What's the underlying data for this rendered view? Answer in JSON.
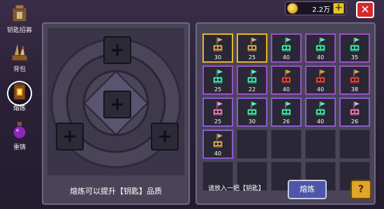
{
  "header": {
    "currency_value": "2.2万",
    "plus_label": "+",
    "close_label": "✕"
  },
  "tabs": [
    {
      "label": "钥匙招募",
      "icon": "altar-icon",
      "active": false
    },
    {
      "label": "背包",
      "icon": "weapon-rack-icon",
      "active": false
    },
    {
      "label": "熔炼",
      "icon": "furnace-icon",
      "active": true
    },
    {
      "label": "重铸",
      "icon": "potion-icon",
      "active": false
    }
  ],
  "smelt_panel": {
    "caption": "熔炼可以提升【钥匙】品质",
    "slot_plus": "+"
  },
  "inventory": {
    "cells": [
      {
        "value": "30",
        "color": "gold",
        "key": "brown"
      },
      {
        "value": "25",
        "color": "gold",
        "key": "brown"
      },
      {
        "value": "40",
        "color": "purple",
        "key": "green"
      },
      {
        "value": "40",
        "color": "purple",
        "key": "green"
      },
      {
        "value": "35",
        "color": "purple",
        "key": "green"
      },
      {
        "value": "25",
        "color": "purple",
        "key": "green"
      },
      {
        "value": "22",
        "color": "purple",
        "key": "green"
      },
      {
        "value": "40",
        "color": "purple",
        "key": "red"
      },
      {
        "value": "40",
        "color": "purple",
        "key": "red"
      },
      {
        "value": "38",
        "color": "purple",
        "key": "red"
      },
      {
        "value": "25",
        "color": "violet",
        "key": "pink"
      },
      {
        "value": "30",
        "color": "violet",
        "key": "green"
      },
      {
        "value": "26",
        "color": "violet",
        "key": "green"
      },
      {
        "value": "40",
        "color": "violet",
        "key": "green"
      },
      {
        "value": "26",
        "color": "violet",
        "key": "pink"
      },
      {
        "value": "40",
        "color": "violet",
        "key": "brown"
      },
      {
        "value": "",
        "color": "empty"
      },
      {
        "value": "",
        "color": "empty"
      },
      {
        "value": "",
        "color": "empty"
      },
      {
        "value": "",
        "color": "empty"
      },
      {
        "value": "",
        "color": "empty"
      },
      {
        "value": "",
        "color": "empty"
      },
      {
        "value": "",
        "color": "empty"
      },
      {
        "value": "",
        "color": "empty"
      },
      {
        "value": "",
        "color": "empty"
      }
    ],
    "hint": "请放入一把【钥匙】",
    "smelt_button": "熔炼",
    "help_button": "?"
  },
  "colors": {
    "gold": "#e4b62a",
    "purple": "#9a4fc7",
    "violet": "#8b5bd0",
    "accent_blue": "#4d56a8",
    "close_red": "#d8282a"
  }
}
